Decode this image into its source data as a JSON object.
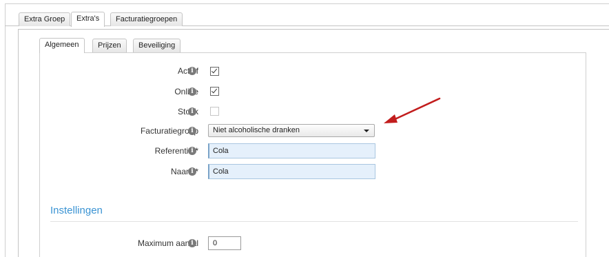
{
  "outer_tabs": [
    {
      "label": "Extra Groep",
      "active": false
    },
    {
      "label": "Extra's",
      "active": true
    },
    {
      "label": "Facturatiegroepen",
      "active": false
    }
  ],
  "inner_tabs": [
    {
      "label": "Algemeen",
      "active": true
    },
    {
      "label": "Prijzen",
      "active": false
    },
    {
      "label": "Beveiliging",
      "active": false
    }
  ],
  "fields": {
    "actief": {
      "label": "Actief",
      "checked": true
    },
    "online": {
      "label": "Online",
      "checked": true
    },
    "stock": {
      "label": "Stock",
      "checked": false,
      "disabled": true
    },
    "facturatiegroep": {
      "label": "Facturatiegroep",
      "value": "Niet alcoholische dranken"
    },
    "referentie": {
      "label": "Referentie *",
      "value": "Cola"
    },
    "naam": {
      "label": "Naam *",
      "value": "Cola"
    }
  },
  "section_title": "Instellingen",
  "maximum_aantal": {
    "label": "Maximum aantal",
    "value": "0"
  },
  "info_glyph": "i",
  "icons": {
    "info": "info-icon",
    "checkbox_tick": "check-icon",
    "dropdown": "chevron-down-icon",
    "annotation": "red-arrow"
  },
  "colors": {
    "section_title": "#3a93d3",
    "input_bg": "#e5f0fb",
    "arrow": "#c21d1d"
  }
}
